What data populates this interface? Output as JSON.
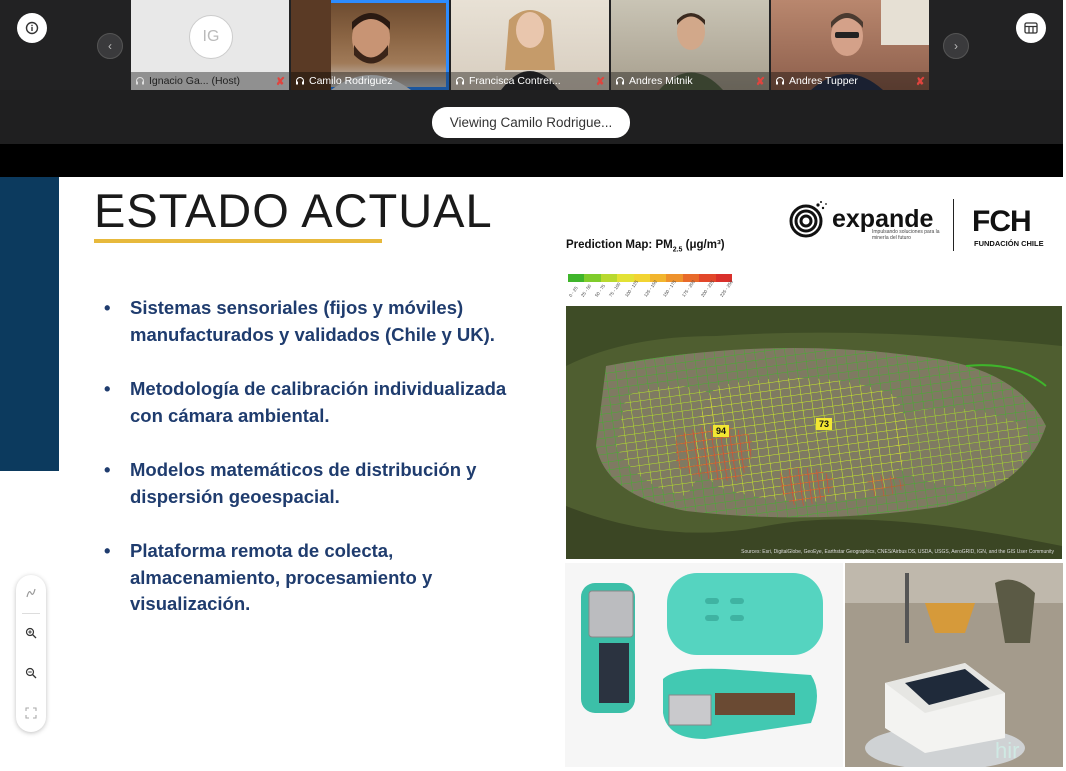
{
  "meeting": {
    "info_icon": "info-icon",
    "layout_icon": "gallery-layout-icon",
    "viewing_label": "Viewing Camilo Rodrigue..."
  },
  "participants": [
    {
      "name": "Ignacio Ga...  (Host)",
      "initials": "IG",
      "muted": true,
      "active": false
    },
    {
      "name": "Camilo Rodriguez",
      "muted": false,
      "active": true
    },
    {
      "name": "Francisca Contrer...",
      "muted": true,
      "active": false
    },
    {
      "name": "Andres Mitnik",
      "muted": true,
      "active": false
    },
    {
      "name": "Andres Tupper",
      "muted": true,
      "active": false
    }
  ],
  "slide": {
    "title": "ESTADO ACTUAL",
    "bullets": [
      "Sistemas sensoriales (fijos y móviles) manufacturados y validados (Chile y UK).",
      "Metodología de calibración individualizada con cámara ambiental.",
      "Modelos matemáticos de distribución y dispersión geoespacial.",
      "Plataforma remota de colecta, almacenamiento, procesamiento y visualización."
    ],
    "logo_expande": "expande",
    "logo_expande_sub": "Impulsando soluciones para la minería del futuro",
    "logo_fch": "FCH",
    "logo_fch_sub": "FUNDACIÓN CHILE",
    "prediction_title": "Prediction Map: PM",
    "prediction_sub": "2.5",
    "prediction_unit": " (μg/m³)",
    "scale_colors": [
      "#3fb52b",
      "#7fcc2b",
      "#b8d92f",
      "#e3e235",
      "#f2d432",
      "#f2b52e",
      "#ee922c",
      "#e86a2a",
      "#e2472a",
      "#d9302b"
    ],
    "scale_ticks": [
      "0 - 25",
      "25 - 50",
      "50 - 75",
      "75 - 100",
      "100 - 125",
      "125 - 150",
      "150 - 175",
      "175 - 200",
      "200 - 225",
      "225 - 250"
    ],
    "map_labels": [
      "94",
      "73"
    ],
    "map_attribution": "Sources: Esri, DigitalGlobe, GeoEye, Earthstar Geographics, CNES/Airbus DS, USDA, USGS, AeroGRID, IGN, and the GIS User Community",
    "photo2_watermark": "hir"
  }
}
